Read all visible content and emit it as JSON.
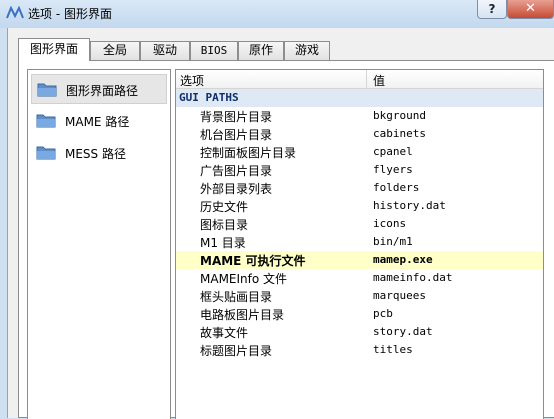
{
  "window": {
    "title": "选项 - 图形界面",
    "help_label": "?",
    "close_label": "✕"
  },
  "tabs": [
    "图形界面",
    "全局",
    "驱动",
    "BIOS",
    "原作",
    "游戏"
  ],
  "active_tab": "图形界面",
  "left_list": {
    "items": [
      "图形界面路径",
      "MAME 路径",
      "MESS 路径"
    ],
    "selected": "图形界面路径"
  },
  "grid": {
    "headers": {
      "option": "选项",
      "value": "值"
    },
    "group": "GUI PATHS",
    "rows": [
      {
        "name": "背景图片目录",
        "value": "bkground"
      },
      {
        "name": "机台图片目录",
        "value": "cabinets"
      },
      {
        "name": "控制面板图片目录",
        "value": "cpanel"
      },
      {
        "name": "广告图片目录",
        "value": "flyers"
      },
      {
        "name": "外部目录列表",
        "value": "folders"
      },
      {
        "name": "历史文件",
        "value": "history.dat"
      },
      {
        "name": "图标目录",
        "value": "icons"
      },
      {
        "name": "M1 目录",
        "value": "bin/m1"
      },
      {
        "name": "MAME 可执行文件",
        "value": "mamep.exe",
        "highlight": true
      },
      {
        "name": "MAMEInfo 文件",
        "value": "mameinfo.dat"
      },
      {
        "name": "框头贴画目录",
        "value": "marquees"
      },
      {
        "name": "电路板图片目录",
        "value": "pcb"
      },
      {
        "name": "故事文件",
        "value": "story.dat"
      },
      {
        "name": "标题图片目录",
        "value": "titles"
      }
    ]
  },
  "colors": {
    "highlight_row": "#ffffc8",
    "group_row": "#dfe9f5",
    "close_button": "#c74a32"
  },
  "icons": {
    "app": "mame-logo-icon",
    "folder": "folder-icon"
  }
}
